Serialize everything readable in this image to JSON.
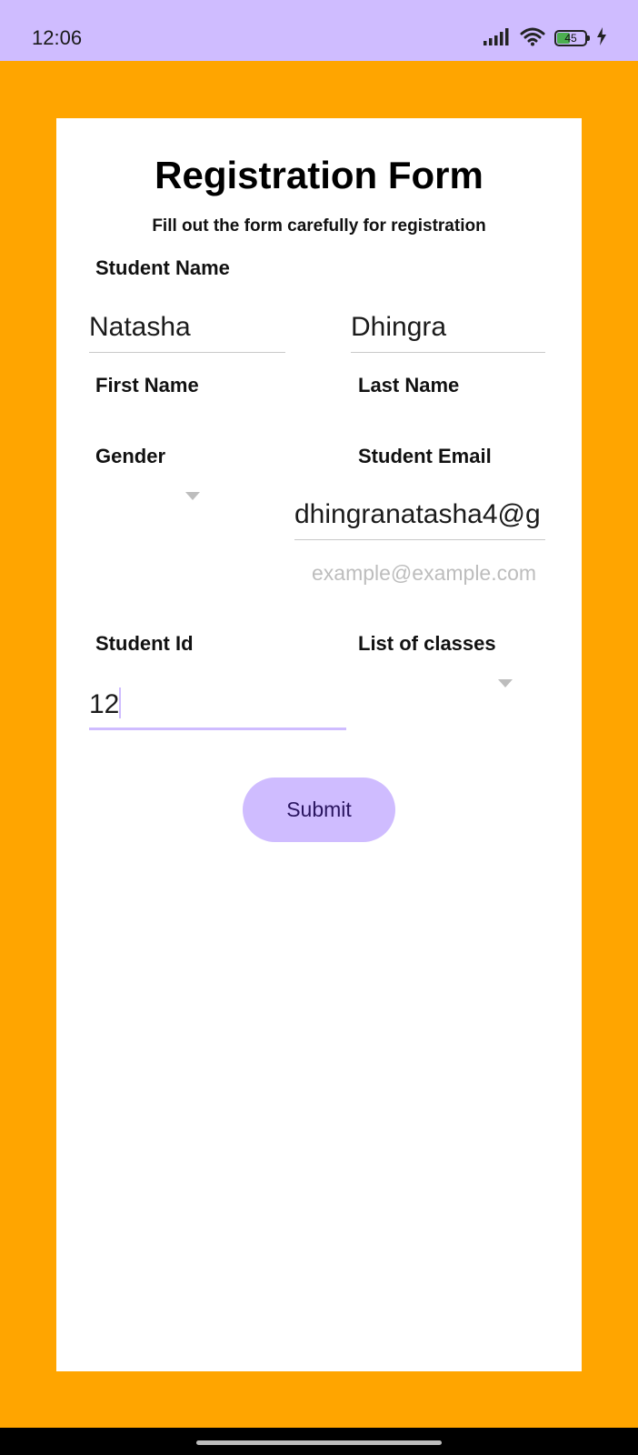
{
  "status_bar": {
    "time": "12:06",
    "battery_level": "45",
    "icons": [
      "signal-icon",
      "wifi-icon",
      "battery-icon",
      "charging-icon"
    ]
  },
  "form": {
    "title": "Registration Form",
    "subtitle": "Fill out the form carefully for registration",
    "student_name_label": "Student Name",
    "first_name": {
      "value": "Natasha",
      "label": "First Name"
    },
    "last_name": {
      "value": "Dhingra",
      "label": "Last Name"
    },
    "gender": {
      "label": "Gender",
      "selected": ""
    },
    "email": {
      "label": "Student Email",
      "value": "dhingranatasha4@g",
      "hint": "example@example.com"
    },
    "student_id": {
      "label": "Student Id",
      "value": "12"
    },
    "classes": {
      "label": "List of classes",
      "selected": ""
    },
    "submit_label": "Submit"
  },
  "colors": {
    "background": "#FFA500",
    "status_bar": "#CFBCFF",
    "accent": "#CFBCFF",
    "button_text": "#2A1560",
    "card": "#FFFFFF"
  }
}
